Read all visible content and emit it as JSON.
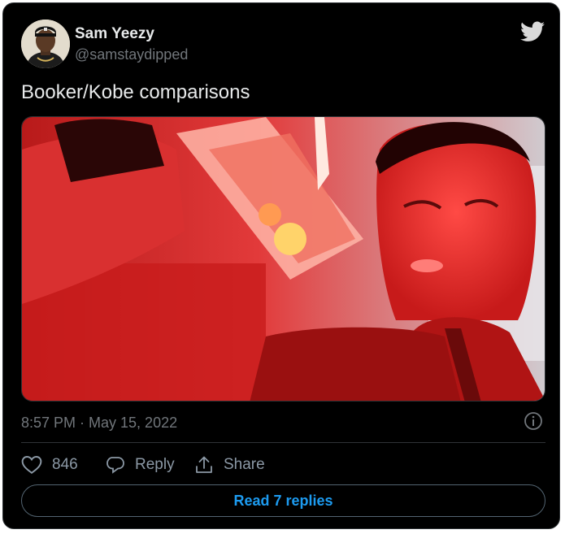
{
  "author": {
    "name": "Sam Yeezy",
    "handle": "@samstaydipped"
  },
  "tweet": {
    "text": "Booker/Kobe comparisons",
    "timestamp": "8:57 PM · May 15, 2022"
  },
  "actions": {
    "like_count": "846",
    "reply_label": "Reply",
    "share_label": "Share"
  },
  "read_replies_label": "Read 7 replies",
  "colors": {
    "background": "#000000",
    "accent": "#1d9bf0",
    "muted": "#71767b"
  },
  "icons": [
    "twitter-bird-icon",
    "info-icon",
    "heart-icon",
    "reply-bubble-icon",
    "share-icon"
  ]
}
